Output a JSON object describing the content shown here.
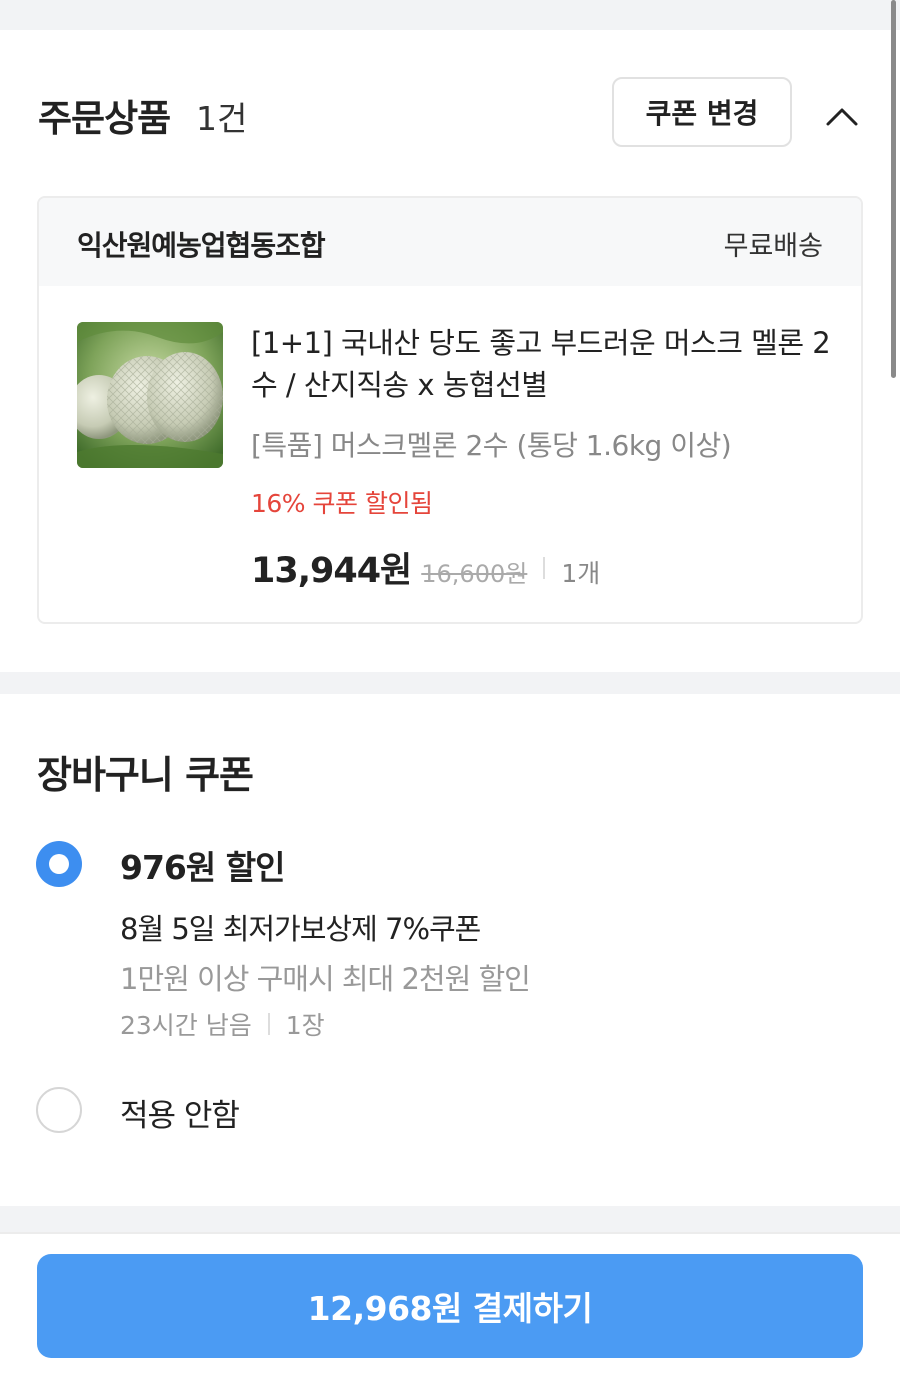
{
  "order": {
    "title": "주문상품",
    "count": "1건",
    "coupon_change_label": "쿠폰 변경",
    "collapse_icon": "chevron-up-icon"
  },
  "seller": {
    "name": "익산원예농업협동조합",
    "shipping": "무료배송"
  },
  "product": {
    "image_icon": "melon-thumbnail",
    "name": "[1+1] 국내산 당도 좋고 부드러운 머스크 멜론 2수 / 산지직송 x 농협선별",
    "option": "[특품] 머스크멜론 2수 (통당 1.6kg 이상)",
    "coupon_applied": "16% 쿠폰 할인됨",
    "price": "13,944원",
    "original_price": "16,600원",
    "quantity": "1개"
  },
  "cart_coupon": {
    "title": "장바구니 쿠폰",
    "options": [
      {
        "selected": true,
        "discount": "976원 할인",
        "name": "8월 5일 최저가보상제 7%쿠폰",
        "condition": "1만원 이상 구매시 최대 2천원 할인",
        "remaining": "23시간 남음",
        "count": "1장"
      },
      {
        "selected": false,
        "label": "적용 안함"
      }
    ]
  },
  "checkout": {
    "pay_label": "12,968원 결제하기"
  },
  "colors": {
    "accent": "#4b9bf3",
    "radio": "#3d8ef0",
    "discount_red": "#e5453b",
    "background_band": "#f2f3f5"
  }
}
